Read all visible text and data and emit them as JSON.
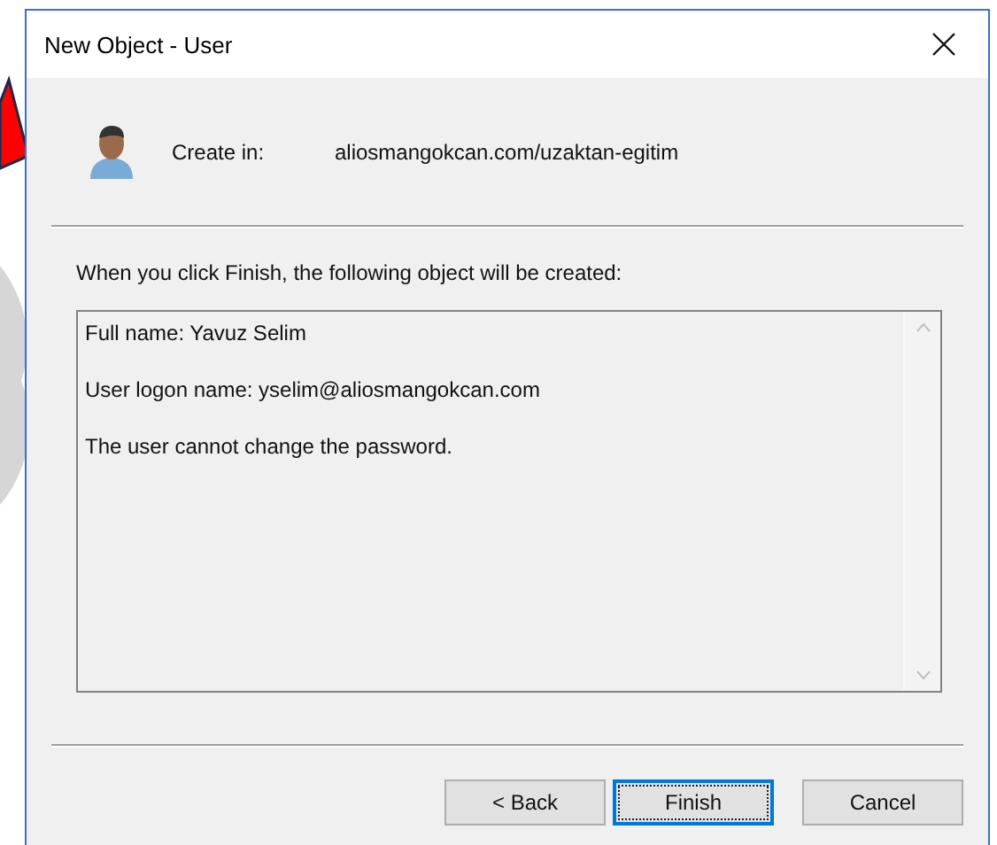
{
  "window": {
    "title": "New Object - User"
  },
  "create_in": {
    "label": "Create in:",
    "path": "aliosmangokcan.com/uzaktan-egitim"
  },
  "intro": "When you click Finish, the following object will be created:",
  "summary_lines": [
    "Full name: Yavuz Selim",
    "User logon name: yselim@aliosmangokcan.com",
    "The user cannot change the password."
  ],
  "buttons": [
    {
      "label": "< Back",
      "default": false
    },
    {
      "label": "Finish",
      "default": true
    },
    {
      "label": "Cancel",
      "default": false
    }
  ]
}
